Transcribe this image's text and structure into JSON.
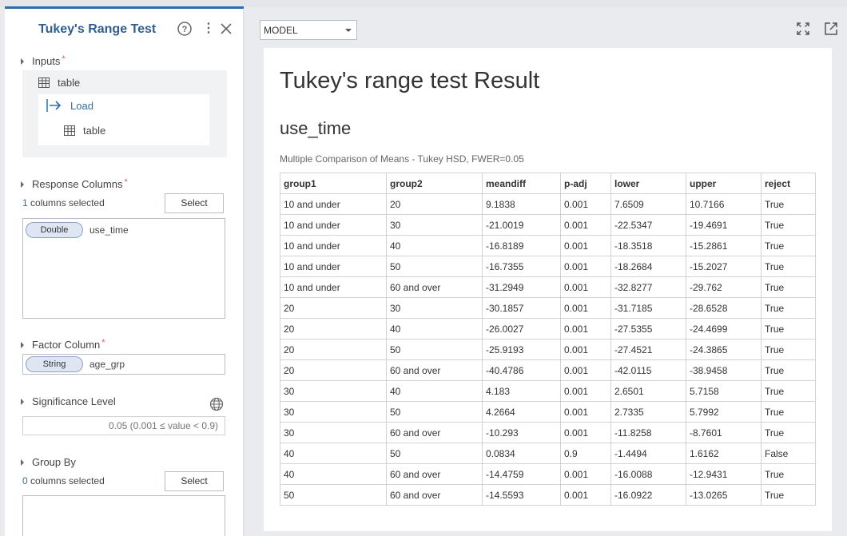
{
  "panel": {
    "title": "Tukey's Range Test",
    "inputs": {
      "label": "Inputs",
      "table_label": "table",
      "load_label": "Load",
      "load_table_label": "table"
    },
    "response_columns": {
      "label": "Response Columns",
      "count": "1",
      "count_suffix": "columns selected",
      "select_label": "Select",
      "columns": [
        {
          "type": "Double",
          "name": "use_time"
        }
      ]
    },
    "factor_column": {
      "label": "Factor Column",
      "type": "String",
      "name": "age_grp"
    },
    "significance": {
      "label": "Significance Level",
      "placeholder": "0.05 (0.001 ≤ value < 0.9)"
    },
    "group_by": {
      "label": "Group By",
      "count": "0",
      "count_suffix": "columns selected",
      "select_label": "Select"
    }
  },
  "toolbar": {
    "model_select": "MODEL"
  },
  "result": {
    "title": "Tukey's range test Result",
    "subtitle": "use_time",
    "caption": "Multiple Comparison of Means - Tukey HSD, FWER=0.05",
    "columns": [
      "group1",
      "group2",
      "meandiff",
      "p-adj",
      "lower",
      "upper",
      "reject"
    ],
    "rows": [
      [
        "10 and under",
        "20",
        "9.1838",
        "0.001",
        "7.6509",
        "10.7166",
        "True"
      ],
      [
        "10 and under",
        "30",
        "-21.0019",
        "0.001",
        "-22.5347",
        "-19.4691",
        "True"
      ],
      [
        "10 and under",
        "40",
        "-16.8189",
        "0.001",
        "-18.3518",
        "-15.2861",
        "True"
      ],
      [
        "10 and under",
        "50",
        "-16.7355",
        "0.001",
        "-18.2684",
        "-15.2027",
        "True"
      ],
      [
        "10 and under",
        "60 and over",
        "-31.2949",
        "0.001",
        "-32.8277",
        "-29.762",
        "True"
      ],
      [
        "20",
        "30",
        "-30.1857",
        "0.001",
        "-31.7185",
        "-28.6528",
        "True"
      ],
      [
        "20",
        "40",
        "-26.0027",
        "0.001",
        "-27.5355",
        "-24.4699",
        "True"
      ],
      [
        "20",
        "50",
        "-25.9193",
        "0.001",
        "-27.4521",
        "-24.3865",
        "True"
      ],
      [
        "20",
        "60 and over",
        "-40.4786",
        "0.001",
        "-42.0115",
        "-38.9458",
        "True"
      ],
      [
        "30",
        "40",
        "4.183",
        "0.001",
        "2.6501",
        "5.7158",
        "True"
      ],
      [
        "30",
        "50",
        "4.2664",
        "0.001",
        "2.7335",
        "5.7992",
        "True"
      ],
      [
        "30",
        "60 and over",
        "-10.293",
        "0.001",
        "-11.8258",
        "-8.7601",
        "True"
      ],
      [
        "40",
        "50",
        "0.0834",
        "0.9",
        "-1.4494",
        "1.6162",
        "False"
      ],
      [
        "40",
        "60 and over",
        "-14.4759",
        "0.001",
        "-16.0088",
        "-12.9431",
        "True"
      ],
      [
        "50",
        "60 and over",
        "-14.5593",
        "0.001",
        "-16.0922",
        "-13.0265",
        "True"
      ]
    ]
  },
  "colors": {
    "accent": "#2e6ea8",
    "title": "#2e5f91",
    "required": "#e05a5a"
  }
}
